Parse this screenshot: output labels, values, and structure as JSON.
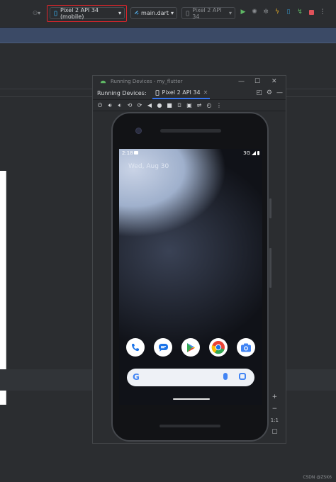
{
  "toolbar": {
    "device_selector": "Pixel 2 API 34 (mobile)",
    "run_config": "main.dart",
    "secondary_device": "Pixel 2 API 34"
  },
  "device_window": {
    "title": "Running Devices - my_flutter",
    "tab_label": "Running Devices:",
    "device_tab": "Pixel 2 API 34",
    "tab_close": "✕"
  },
  "phone": {
    "status_time": "2:18",
    "network": "3G",
    "date": "Wed, Aug 30"
  },
  "side_tools": {
    "zoom_in": "+",
    "zoom_out": "−",
    "actual_size": "1:1"
  },
  "watermark": "CSDN @ZSK6",
  "colors": {
    "highlight": "#e0252b",
    "accent": "#3574f0",
    "run_green": "#5fb865",
    "stop_red": "#e0525a"
  },
  "icons": [
    "run-icon",
    "debug-icon",
    "settings-icon",
    "hot-reload-icon",
    "device-icon",
    "attach-icon",
    "stop-icon",
    "phone-app-icon",
    "messages-app-icon",
    "play-store-icon",
    "chrome-icon",
    "camera-app-icon"
  ]
}
